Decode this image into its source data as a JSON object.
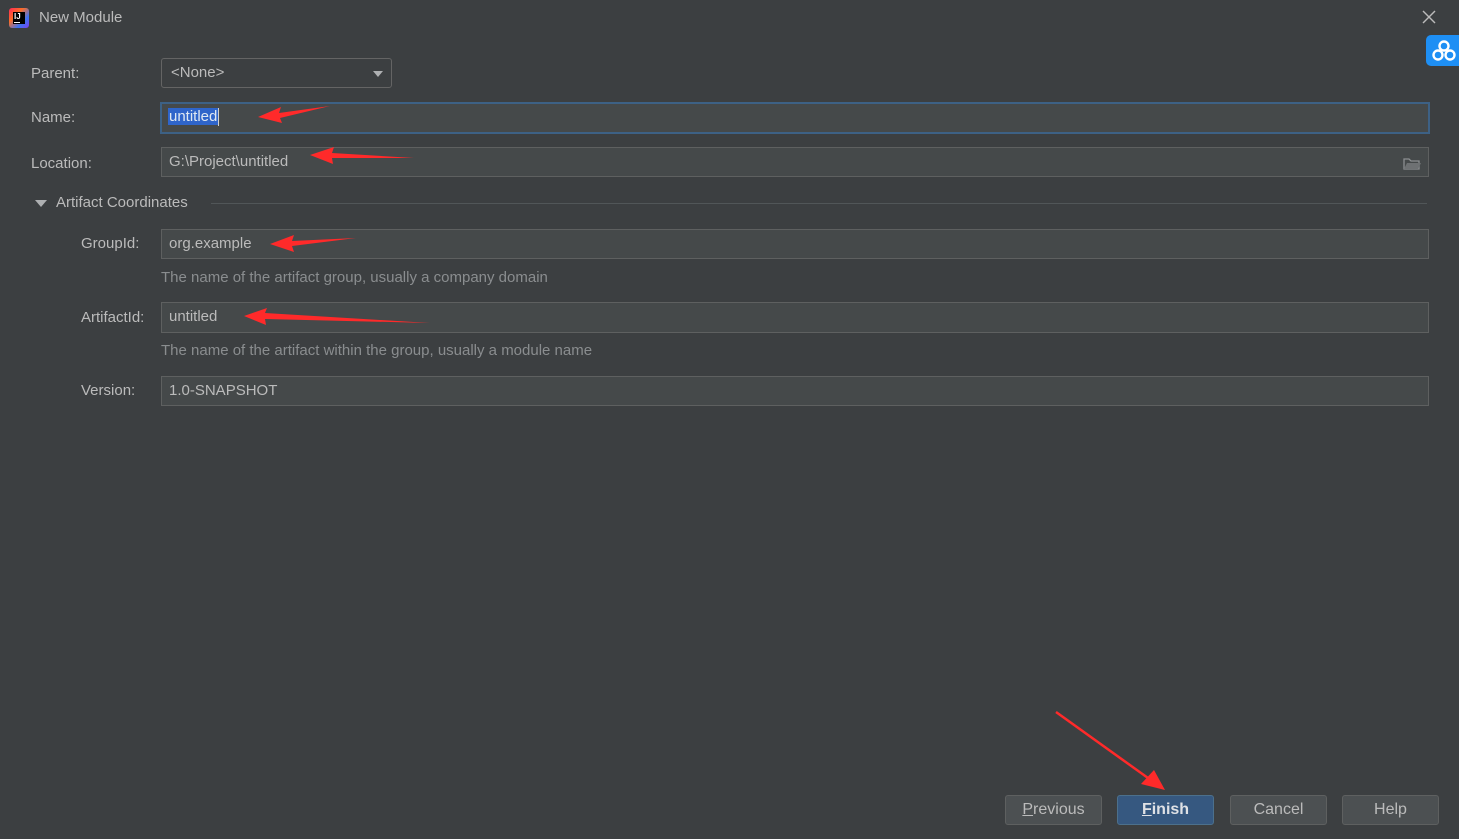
{
  "window": {
    "title": "New Module",
    "app_icon": "intellij-idea-icon",
    "close_icon": "close-icon"
  },
  "side_badge_icon": "cloud-sync-icon",
  "form": {
    "parent_label": "Parent:",
    "parent_value": "<None>",
    "name_label": "Name:",
    "name_value": "untitled",
    "location_label": "Location:",
    "location_value": "G:\\Project\\untitled",
    "section_label": "Artifact Coordinates",
    "groupid_label": "GroupId:",
    "groupid_value": "org.example",
    "groupid_hint": "The name of the artifact group, usually a company domain",
    "artifactid_label": "ArtifactId:",
    "artifactid_value": "untitled",
    "artifactid_hint": "The name of the artifact within the group, usually a module name",
    "version_label": "Version:",
    "version_value": "1.0-SNAPSHOT"
  },
  "buttons": {
    "previous_mnemonic": "P",
    "previous_rest": "revious",
    "finish_mnemonic": "F",
    "finish_rest": "inish",
    "cancel": "Cancel",
    "help": "Help"
  },
  "annotation_color": "#ff2a2a"
}
